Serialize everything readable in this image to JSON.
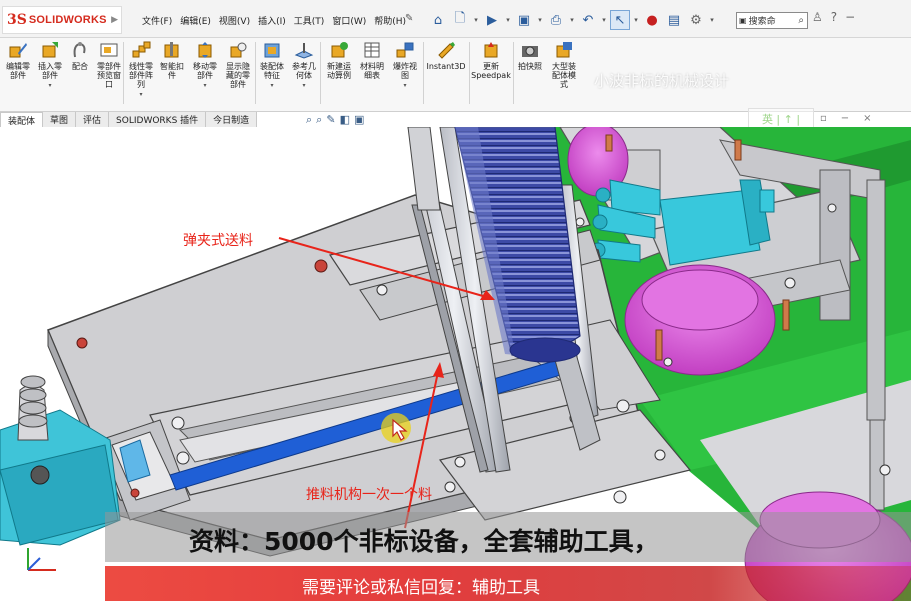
{
  "app": {
    "logo_prefix": "3S",
    "logo_text": "SOLIDWORKS"
  },
  "menu": [
    "文件(F)",
    "编辑(E)",
    "视图(V)",
    "插入(I)",
    "工具(T)",
    "窗口(W)",
    "帮助(H)"
  ],
  "search": {
    "label": "搜索命"
  },
  "ribbon": [
    {
      "label": "编辑零\n部件",
      "icon": "edit-component-icon"
    },
    {
      "label": "插入零\n部件",
      "icon": "insert-component-icon",
      "dropdown": true
    },
    {
      "label": "配合",
      "icon": "mate-icon"
    },
    {
      "label": "零部件\n预览窗\n口",
      "icon": "component-preview-icon"
    },
    {
      "label": "线性零\n部件阵\n列",
      "icon": "linear-pattern-icon",
      "dropdown": true
    },
    {
      "label": "智能扣\n件",
      "icon": "smart-fastener-icon"
    },
    {
      "label": "移动零\n部件",
      "icon": "move-component-icon",
      "dropdown": true
    },
    {
      "label": "显示隐\n藏的零\n部件",
      "icon": "show-hidden-icon"
    },
    {
      "label": "装配体\n特征",
      "icon": "assembly-feature-icon",
      "dropdown": true
    },
    {
      "label": "参考几\n何体",
      "icon": "reference-geometry-icon",
      "dropdown": true
    },
    {
      "label": "新建运\n动算例",
      "icon": "motion-study-icon"
    },
    {
      "label": "材料明\n细表",
      "icon": "bom-icon"
    },
    {
      "label": "爆炸视\n图",
      "icon": "exploded-view-icon",
      "dropdown": true
    },
    {
      "label": "Instant3D",
      "icon": "instant3d-icon"
    },
    {
      "label": "更新\nSpeedpak",
      "icon": "speedpak-icon"
    },
    {
      "label": "拍快照",
      "icon": "snapshot-icon"
    },
    {
      "label": "大型装\n配体模\n式",
      "icon": "large-assembly-icon"
    }
  ],
  "tabs": [
    "装配体",
    "草图",
    "评估",
    "SOLIDWORKS 插件",
    "今日制造"
  ],
  "active_tab": 0,
  "watermark": {
    "top_text": "小波非标的机械设计",
    "logo_text": "英 | ↑ |"
  },
  "annotations": {
    "feed_label": "弹夹式送料",
    "push_label": "推料机构一次一个料"
  },
  "captions": {
    "main": "资料：5000个非标设备，全套辅助工具，",
    "sub": "需要评论或私信回复：辅助工具"
  },
  "colors": {
    "spring_blue": "#3d4aa6",
    "pusher_blue": "#1f5fd6",
    "cylinder_cyan": "#38c8dc",
    "wheel_magenta": "#d94fd9",
    "green_rail": "#27b53a",
    "annotation_red": "#e8241a",
    "plate_gray": "#cfcfd2"
  }
}
